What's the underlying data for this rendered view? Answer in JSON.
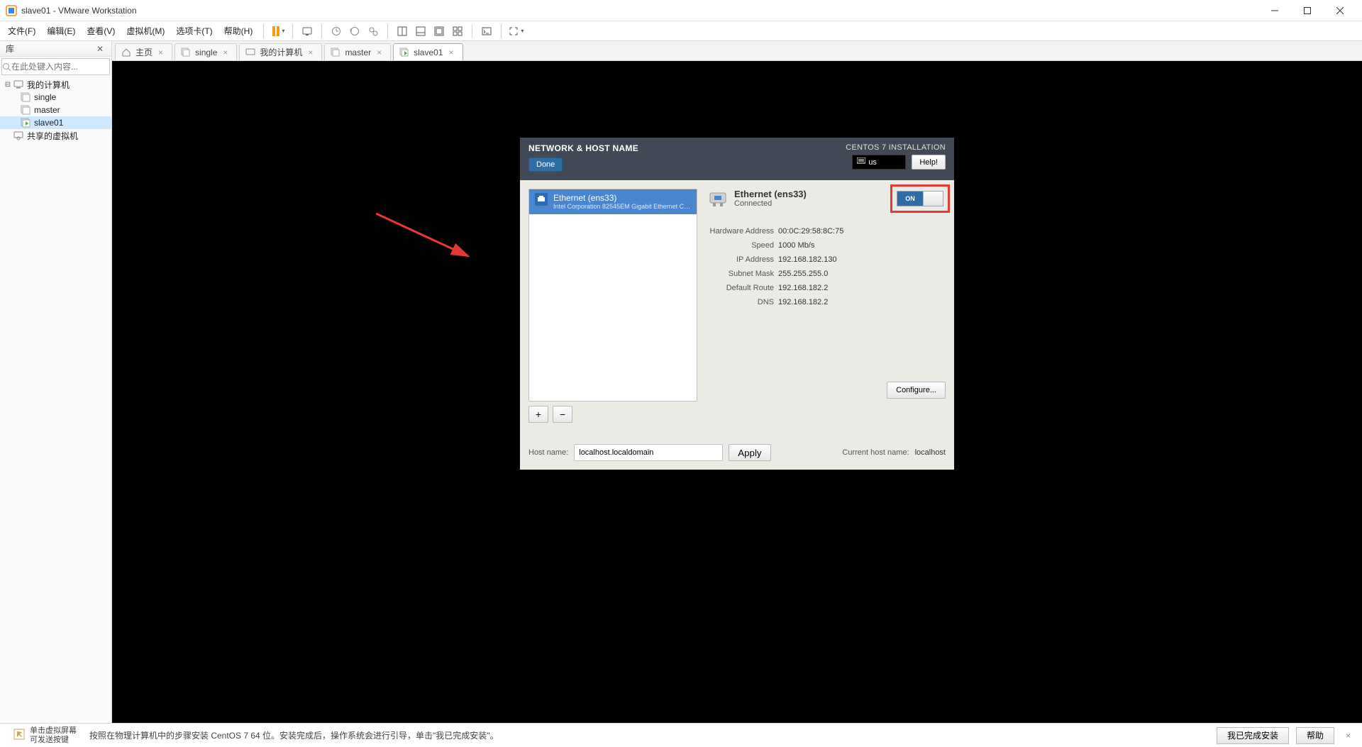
{
  "window": {
    "title": "slave01 - VMware Workstation"
  },
  "menu": {
    "file": "文件(F)",
    "edit": "编辑(E)",
    "view": "查看(V)",
    "vm": "虚拟机(M)",
    "tabs": "选项卡(T)",
    "help": "帮助(H)"
  },
  "sidebar": {
    "title": "库",
    "search_placeholder": "在此处键入内容...",
    "root": "我的计算机",
    "items": [
      "single",
      "master",
      "slave01"
    ],
    "shared": "共享的虚拟机"
  },
  "tabs": {
    "home": "主页",
    "items": [
      "single",
      "我的计算机",
      "master",
      "slave01"
    ],
    "active": "slave01"
  },
  "cent": {
    "title": "NETWORK & HOST NAME",
    "done": "Done",
    "install": "CENTOS 7 INSTALLATION",
    "kb": "us",
    "help": "Help!",
    "iface": {
      "name": "Ethernet (ens33)",
      "sub": "Intel Corporation 82545EM Gigabit Ethernet Controller (",
      "dname": "Ethernet (ens33)",
      "status": "Connected",
      "toggle": "ON",
      "hw_label": "Hardware Address",
      "hw": "00:0C:29:58:8C:75",
      "speed_label": "Speed",
      "speed": "1000 Mb/s",
      "ip_label": "IP Address",
      "ip": "192.168.182.130",
      "mask_label": "Subnet Mask",
      "mask": "255.255.255.0",
      "gw_label": "Default Route",
      "gw": "192.168.182.2",
      "dns_label": "DNS",
      "dns": "192.168.182.2"
    },
    "add": "+",
    "remove": "−",
    "configure": "Configure...",
    "hostname_label": "Host name:",
    "hostname": "localhost.localdomain",
    "apply": "Apply",
    "cur_label": "Current host name:",
    "cur_host": "localhost"
  },
  "footer": {
    "hint1": "单击虚拟屏幕",
    "hint2": "可发送按键",
    "msg": "按照在物理计算机中的步骤安装 CentOS 7 64 位。安装完成后，操作系统会进行引导，单击\"我已完成安装\"。",
    "done_install": "我已完成安装",
    "help": "帮助"
  }
}
